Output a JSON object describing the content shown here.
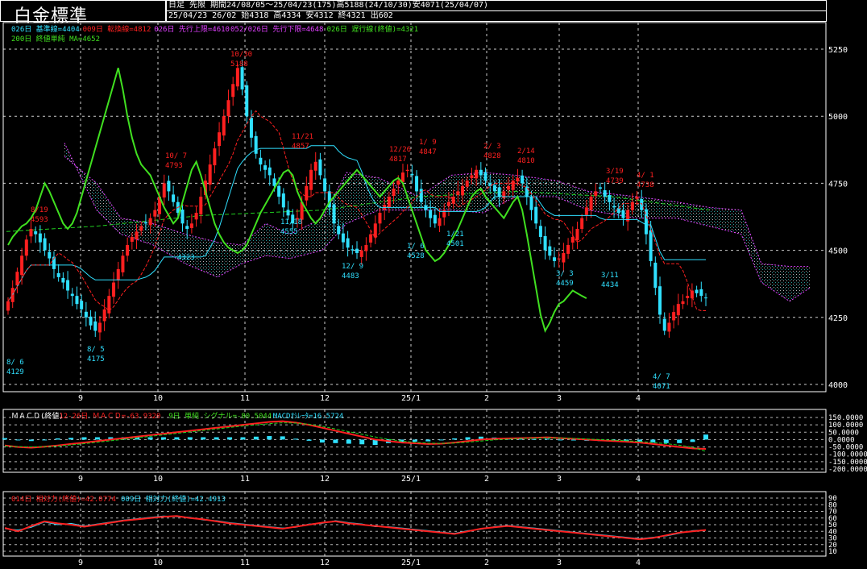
{
  "header": {
    "title": "白金標準",
    "line1": "日足 先限 期間24/08/05～25/04/23(175)高5188(24/10/30)安4071(25/04/07)",
    "line2": "25/04/23 26/02 始4318 高4334 安4312 終4321 出602"
  },
  "colors": {
    "bg": "#000000",
    "up": "#ff2020",
    "down": "#30e0ff",
    "ma200": "#20d020",
    "kijun": "#30e0ff",
    "tenkan": "#ff2020",
    "senkou": "#e040ff",
    "chikou": "#40e020",
    "grid": "#ffffff"
  },
  "legend": {
    "row1": [
      {
        "text": "026日 基準線=4404",
        "color": "#30e0ff"
      },
      {
        "text": "009日 転換線=4812",
        "color": "#ff2020"
      },
      {
        "text": "026日 先行上限=4610",
        "color": "#e040ff"
      },
      {
        "text": "052/026日 先行下限=4648",
        "color": "#e040ff"
      },
      {
        "text": "026日 遅行線(終値)=4321",
        "color": "#40e020"
      }
    ],
    "row2": [
      {
        "text": "200日 終値単純 MA=4652",
        "color": "#40e020"
      }
    ],
    "macd": [
      {
        "text": "ＭＡＣＤ(終値)",
        "color": "#ffffff"
      },
      {
        "text": "12-26日 ＭＡＣＤ=-63.9320",
        "color": "#ff2020"
      },
      {
        "text": "9日 単純 シグナル=-80.5044",
        "color": "#40e020"
      },
      {
        "text": "MACDｵｼﾚｰﾀ=16.5724",
        "color": "#30e0ff"
      }
    ],
    "rsi": [
      {
        "text": "014日 相対力(終値)=42.0774",
        "color": "#ff2020"
      },
      {
        "text": "009日 相対力(終値)=42.4913",
        "color": "#30e0ff"
      }
    ]
  },
  "chart_data": {
    "type": "candlestick",
    "price_ticks": [
      "5250",
      "5000",
      "4750",
      "4500",
      "4250",
      "4000"
    ],
    "price_ylim": [
      4000,
      5250
    ],
    "x_labels": [
      "9",
      "10",
      "11",
      "12",
      "25/1",
      "2",
      "3",
      "4"
    ],
    "macd_ticks": [
      "150.0000",
      "100.0000",
      "50.0000",
      "0.0000",
      "-50.0000",
      "-100.0000",
      "-150.0000",
      "-200.0000"
    ],
    "macd_ylim": [
      -200,
      150
    ],
    "rsi_ticks": [
      "90",
      "80",
      "70",
      "60",
      "50",
      "40",
      "30",
      "20",
      "10"
    ],
    "rsi_ylim": [
      10,
      90
    ],
    "annotations": [
      {
        "date": "8/ 6",
        "value": "4129",
        "color": "#30e0ff"
      },
      {
        "date": "8/19",
        "value": "4593",
        "color": "#ff2020"
      },
      {
        "date": "8/ 5",
        "value": "4175",
        "color": "#30e0ff"
      },
      {
        "date": "10/ 7",
        "value": "4793",
        "color": "#ff2020"
      },
      {
        "date": "",
        "value": "4323",
        "color": "#30e0ff"
      },
      {
        "date": "10/30",
        "value": "5188",
        "color": "#ff2020"
      },
      {
        "date": "11/21",
        "value": "4857",
        "color": "#ff2020"
      },
      {
        "date": "11/18",
        "value": "4555",
        "color": "#30e0ff"
      },
      {
        "date": "12/ 9",
        "value": "4483",
        "color": "#30e0ff"
      },
      {
        "date": "12/26",
        "value": "4817",
        "color": "#ff2020"
      },
      {
        "date": "1/ 9",
        "value": "4847",
        "color": "#ff2020"
      },
      {
        "date": "1/ 6",
        "value": "4528",
        "color": "#30e0ff"
      },
      {
        "date": "1/21",
        "value": "4501",
        "color": "#30e0ff"
      },
      {
        "date": "2/ 3",
        "value": "4828",
        "color": "#ff2020"
      },
      {
        "date": "2/14",
        "value": "4810",
        "color": "#ff2020"
      },
      {
        "date": "3/ 3",
        "value": "4459",
        "color": "#30e0ff"
      },
      {
        "date": "3/11",
        "value": "4434",
        "color": "#30e0ff"
      },
      {
        "date": "3/19",
        "value": "4739",
        "color": "#ff2020"
      },
      {
        "date": "4/ 1",
        "value": "4738",
        "color": "#ff2020"
      },
      {
        "date": "4/ 7",
        "value": "4071",
        "color": "#30e0ff"
      }
    ],
    "closes": [
      4310,
      4360,
      4420,
      4480,
      4540,
      4580,
      4560,
      4530,
      4500,
      4470,
      4430,
      4400,
      4380,
      4350,
      4330,
      4300,
      4280,
      4250,
      4220,
      4200,
      4230,
      4280,
      4330,
      4380,
      4430,
      4480,
      4520,
      4550,
      4570,
      4590,
      4600,
      4620,
      4650,
      4700,
      4750,
      4720,
      4680,
      4640,
      4600,
      4580,
      4600,
      4640,
      4700,
      4760,
      4820,
      4880,
      4940,
      5000,
      5060,
      5120,
      5180,
      5100,
      5000,
      4920,
      4860,
      4820,
      4800,
      4780,
      4740,
      4700,
      4660,
      4630,
      4600,
      4620,
      4680,
      4740,
      4800,
      4830,
      4780,
      4720,
      4660,
      4600,
      4560,
      4530,
      4510,
      4500,
      4490,
      4500,
      4520,
      4560,
      4600,
      4640,
      4670,
      4700,
      4730,
      4760,
      4790,
      4800,
      4780,
      4720,
      4680,
      4650,
      4620,
      4600,
      4620,
      4650,
      4680,
      4700,
      4720,
      4740,
      4760,
      4780,
      4800,
      4780,
      4760,
      4740,
      4720,
      4700,
      4720,
      4740,
      4760,
      4770,
      4750,
      4700,
      4650,
      4600,
      4550,
      4500,
      4480,
      4460,
      4470,
      4490,
      4520,
      4550,
      4580,
      4620,
      4660,
      4700,
      4720,
      4730,
      4700,
      4680,
      4660,
      4640,
      4620,
      4650,
      4680,
      4700,
      4650,
      4560,
      4460,
      4360,
      4260,
      4200,
      4230,
      4270,
      4300,
      4310,
      4330,
      4350,
      4340,
      4330,
      4321
    ],
    "macd": [
      -40,
      -50,
      -55,
      -48,
      -40,
      -30,
      -20,
      -10,
      0,
      10,
      20,
      30,
      40,
      50,
      60,
      70,
      80,
      90,
      100,
      110,
      120,
      125,
      115,
      100,
      80,
      60,
      40,
      20,
      0,
      -10,
      -20,
      -25,
      -30,
      -28,
      -20,
      -10,
      0,
      5,
      8,
      10,
      12,
      15,
      10,
      5,
      0,
      -5,
      -10,
      -15,
      -20,
      -30,
      -40,
      -50,
      -60,
      -63
    ],
    "macd_signal": [
      -45,
      -48,
      -50,
      -48,
      -44,
      -36,
      -28,
      -18,
      -8,
      2,
      12,
      22,
      32,
      42,
      52,
      62,
      72,
      82,
      92,
      100,
      108,
      114,
      112,
      104,
      90,
      72,
      54,
      36,
      18,
      2,
      -10,
      -18,
      -24,
      -26,
      -24,
      -18,
      -10,
      -2,
      3,
      7,
      10,
      12,
      11,
      8,
      4,
      0,
      -4,
      -8,
      -13,
      -20,
      -28,
      -38,
      -52,
      -80
    ],
    "rsi14": [
      45,
      40,
      48,
      55,
      52,
      50,
      47,
      50,
      53,
      56,
      58,
      60,
      62,
      63,
      60,
      58,
      55,
      52,
      50,
      48,
      46,
      44,
      47,
      50,
      53,
      55,
      52,
      50,
      48,
      46,
      44,
      42,
      40,
      38,
      36,
      40,
      44,
      46,
      48,
      46,
      44,
      42,
      40,
      38,
      36,
      34,
      32,
      30,
      28,
      30,
      34,
      38,
      40,
      42
    ],
    "rsi9": [
      44,
      42,
      46,
      54,
      50,
      52,
      48,
      51,
      54,
      57,
      59,
      61,
      63,
      62,
      61,
      57,
      56,
      53,
      51,
      49,
      47,
      45,
      46,
      51,
      52,
      56,
      53,
      51,
      47,
      47,
      45,
      43,
      41,
      39,
      37,
      41,
      43,
      47,
      49,
      47,
      45,
      43,
      41,
      39,
      37,
      35,
      33,
      31,
      29,
      31,
      33,
      37,
      41,
      42
    ]
  }
}
